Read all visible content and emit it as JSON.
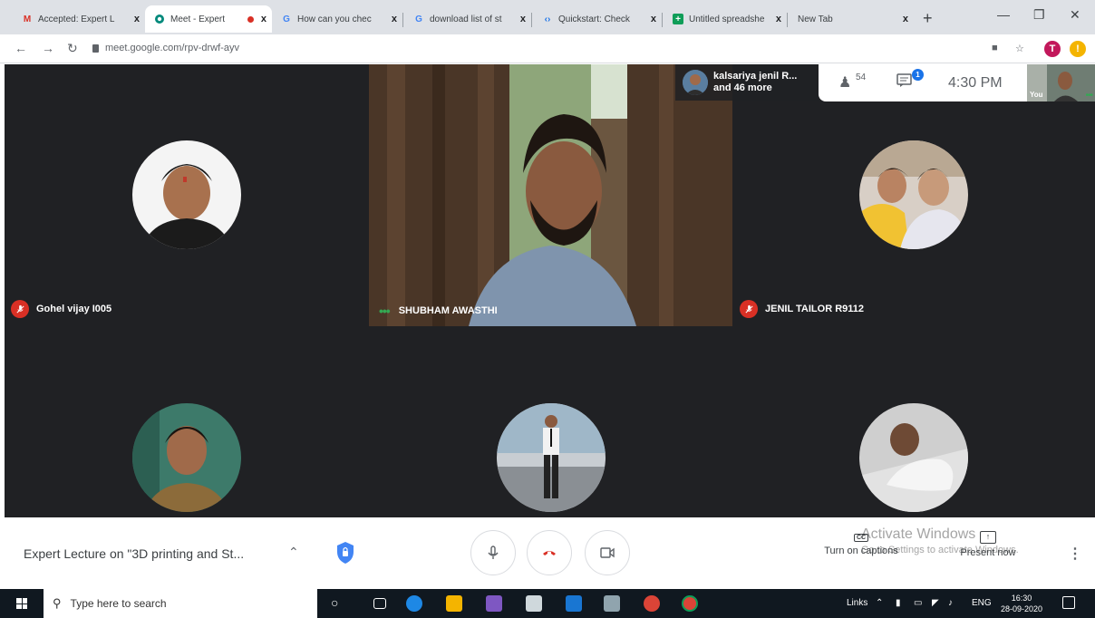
{
  "browser": {
    "tabs": [
      {
        "title": "Accepted: Expert L",
        "icon": "gmail-icon",
        "active": false
      },
      {
        "title": "Meet - Expert",
        "icon": "meet-icon",
        "active": true,
        "recording": true
      },
      {
        "title": "How can you chec",
        "icon": "google-icon",
        "active": false
      },
      {
        "title": "download list of st",
        "icon": "google-icon",
        "active": false
      },
      {
        "title": "Quickstart: Check",
        "icon": "code-icon",
        "active": false
      },
      {
        "title": "Untitled spreadshe",
        "icon": "sheets-icon",
        "active": false
      },
      {
        "title": "New Tab",
        "icon": "",
        "active": false
      }
    ],
    "new_tab_symbol": "+",
    "close_symbol": "x",
    "url": "meet.google.com/rpv-drwf-ayv",
    "profile_letter": "T",
    "alert_symbol": "!"
  },
  "meet": {
    "participants": [
      {
        "name": "Gohel vijay I005",
        "muted": true
      },
      {
        "name": "SHUBHAM AWASTHI",
        "muted": false,
        "video": true
      },
      {
        "name": "JENIL TAILOR R9112",
        "muted": true
      }
    ],
    "more": {
      "line1": "kalsariya jenil R...",
      "line2": "and 46 more"
    },
    "people_count": "54",
    "chat_unread": "1",
    "time": "4:30 PM",
    "self_label": "You",
    "meeting_title": "Expert Lecture on \"3D printing and St...",
    "captions_label": "Turn on captions",
    "captions_icon_text": "CC",
    "present_label": "Present now",
    "watermark_line1": "Activate Windows",
    "watermark_line2": "Go to Settings to activate Windows."
  },
  "taskbar": {
    "search_placeholder": "Type here to search",
    "tray_links": "Links",
    "tray_lang": "ENG",
    "clock_time": "16:30",
    "clock_date": "28-09-2020"
  },
  "colors": {
    "meet_bg": "#202124",
    "mute_red": "#d93025",
    "accent_blue": "#1a73e8",
    "taskbar_bg": "#101820"
  }
}
